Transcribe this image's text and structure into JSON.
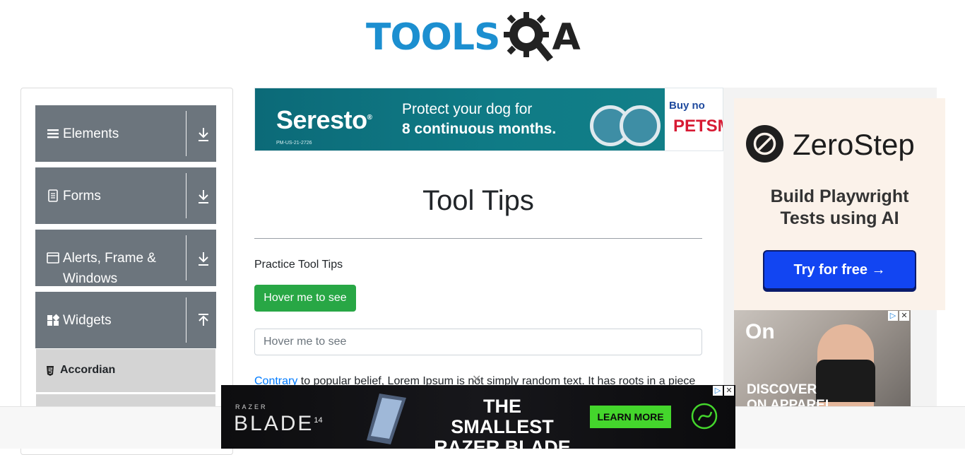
{
  "header": {
    "logo_text": "TOOLS",
    "logo_suffix": "A"
  },
  "sidebar": {
    "groups": [
      {
        "label": "Elements",
        "icon": "hamburger-icon",
        "state": "collapsed"
      },
      {
        "label": "Forms",
        "icon": "document-icon",
        "state": "collapsed"
      },
      {
        "label": "Alerts, Frame & Windows",
        "icon": "window-icon",
        "state": "collapsed"
      },
      {
        "label": "Widgets",
        "icon": "widgets-grid-icon",
        "state": "expanded"
      }
    ],
    "widget_items": [
      {
        "label": "Accordian",
        "icon": "html-icon"
      }
    ],
    "colors": {
      "group_bg": "#6c757d",
      "item_bg": "#d4d4d4"
    }
  },
  "top_ad": {
    "brand": "Seresto",
    "brand_mark": "®",
    "fine_print": "PM-US-21-2726",
    "line1": "Protect your dog for",
    "line2": "8 continuous months.",
    "side_cta": "Buy no",
    "side_store": "PETSM"
  },
  "main": {
    "title": "Tool Tips",
    "practice_label": "Practice Tool Tips",
    "hover_button_label": "Hover me to see",
    "hover_input_placeholder": "Hover me to see",
    "paragraph_link": "Contrary",
    "paragraph_text": " to popular belief, Lorem Ipsum is not simply random text. It has roots in a piece",
    "close_glyph": "✕"
  },
  "right_ads": {
    "zerostep": {
      "name": "ZeroStep",
      "tagline_1": "Build Playwright",
      "tagline_2": "Tests using AI",
      "cta": "Try for free →"
    },
    "on": {
      "logo": "On",
      "text_1": "DISCOVER",
      "text_2": "ON APPAREL"
    },
    "adchoices": "▷",
    "close": "✕"
  },
  "bottom_ad": {
    "brand_small": "RAZER",
    "product": "BLADE",
    "product_size": "14",
    "headline_1": "THE SMALLEST",
    "headline_2": "RAZER BLADE",
    "cta": "LEARN MORE",
    "accent": "#44d62c"
  }
}
